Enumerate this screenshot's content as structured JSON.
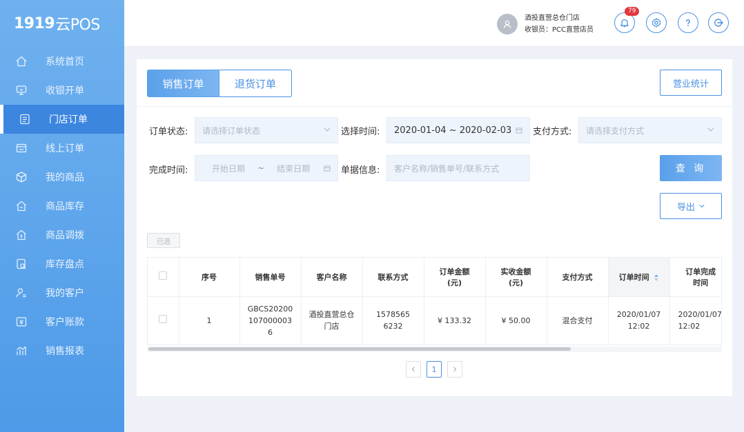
{
  "app": {
    "logo_num": "1919",
    "logo_text": "云POS"
  },
  "sidebar": {
    "items": [
      {
        "label": "系统首页",
        "icon": "home-icon"
      },
      {
        "label": "收银开单",
        "icon": "cashier-icon"
      },
      {
        "label": "门店订单",
        "icon": "order-icon",
        "active": true
      },
      {
        "label": "线上订单",
        "icon": "online-order-icon"
      },
      {
        "label": "我的商品",
        "icon": "box-icon"
      },
      {
        "label": "商品库存",
        "icon": "inventory-icon"
      },
      {
        "label": "商品调拨",
        "icon": "transfer-icon"
      },
      {
        "label": "库存盘点",
        "icon": "stocktake-icon"
      },
      {
        "label": "我的客户",
        "icon": "customer-icon"
      },
      {
        "label": "客户账款",
        "icon": "account-icon"
      },
      {
        "label": "销售报表",
        "icon": "chart-icon"
      }
    ]
  },
  "header": {
    "store_name": "酒投直营总仓门店",
    "cashier": "收银员：PCC直营店员",
    "notification_count": "79"
  },
  "tabs": {
    "sales": "销售订单",
    "returns": "退货订单"
  },
  "stats_button": "营业统计",
  "filters": {
    "status_label": "订单状态:",
    "status_placeholder": "请选择订单状态",
    "time_label": "选择时间:",
    "time_value": "2020-01-04 ~ 2020-02-03",
    "payment_label": "支付方式:",
    "payment_placeholder": "请选择支付方式",
    "complete_label": "完成时间:",
    "start_placeholder": "开始日期",
    "range_sep": "~",
    "end_placeholder": "结束日期",
    "doc_label": "单据信息:",
    "doc_placeholder": "客户名称/销售单号/联系方式"
  },
  "query_button": "查 询",
  "export_button": "导出",
  "selected_button": "已选",
  "table": {
    "headers": [
      "序号",
      "销售单号",
      "客户名称",
      "联系方式",
      "订单金额\n(元)",
      "实收金额\n(元)",
      "支付方式",
      "订单时间",
      "订单完成\n时间"
    ],
    "rows": [
      {
        "index": "1",
        "order_no": "GBCS20200107000003 6",
        "customer": "酒投直营总仓门店",
        "phone": "15785656232",
        "amount": "¥ 133.32",
        "received": "¥ 50.00",
        "payment": "混合支付",
        "order_time": "2020/01/07 12:02",
        "complete_time": "2020/01/07 12:02"
      }
    ]
  },
  "pager": {
    "current": "1"
  }
}
